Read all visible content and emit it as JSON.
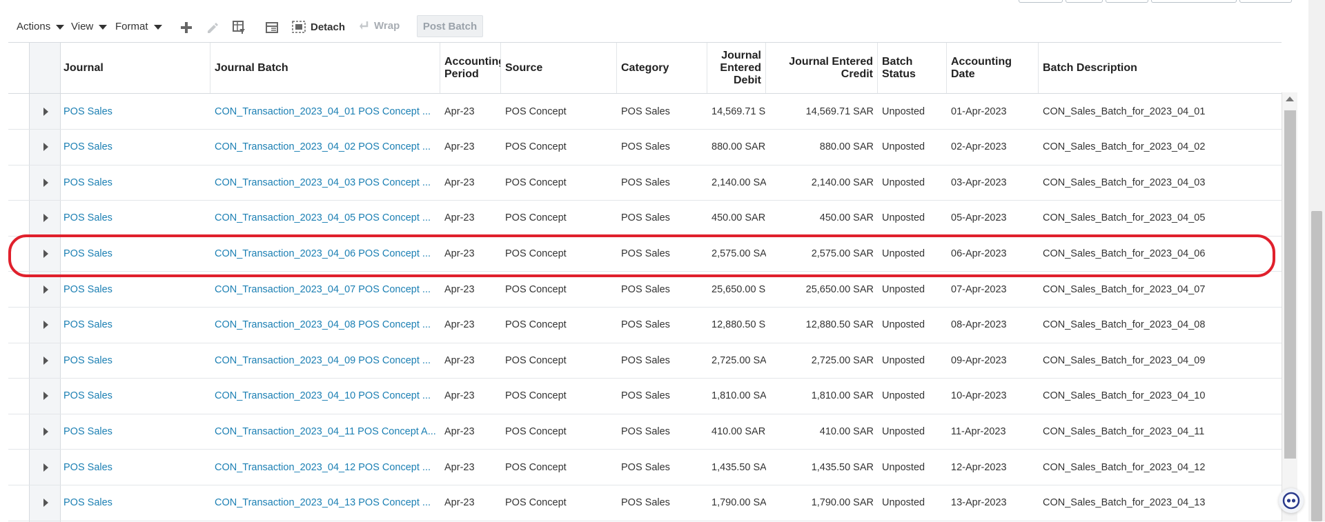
{
  "toolbar": {
    "actions_label": "Actions",
    "view_label": "View",
    "format_label": "Format",
    "detach_label": "Detach",
    "wrap_label": "Wrap",
    "post_batch_label": "Post Batch"
  },
  "table": {
    "headers": {
      "journal": "Journal",
      "journal_batch": "Journal Batch",
      "accounting_period": "Accounting Period",
      "source": "Source",
      "category": "Category",
      "journal_entered_debit": "Journal Entered Debit",
      "journal_entered_credit": "Journal Entered Credit",
      "batch_status": "Batch Status",
      "accounting_date": "Accounting Date",
      "batch_description": "Batch Description"
    },
    "rows": [
      {
        "journal": "POS Sales",
        "batch": "CON_Transaction_2023_04_01 POS Concept ...",
        "period": "Apr-23",
        "source": "POS Concept",
        "category": "POS Sales",
        "debit": "14,569.71 S",
        "credit": "14,569.71 SAR",
        "status": "Unposted",
        "date": "01-Apr-2023",
        "description": "CON_Sales_Batch_for_2023_04_01"
      },
      {
        "journal": "POS Sales",
        "batch": "CON_Transaction_2023_04_02 POS Concept ...",
        "period": "Apr-23",
        "source": "POS Concept",
        "category": "POS Sales",
        "debit": "880.00 SAR",
        "credit": "880.00 SAR",
        "status": "Unposted",
        "date": "02-Apr-2023",
        "description": "CON_Sales_Batch_for_2023_04_02"
      },
      {
        "journal": "POS Sales",
        "batch": "CON_Transaction_2023_04_03 POS Concept ...",
        "period": "Apr-23",
        "source": "POS Concept",
        "category": "POS Sales",
        "debit": "2,140.00 SA",
        "credit": "2,140.00 SAR",
        "status": "Unposted",
        "date": "03-Apr-2023",
        "description": "CON_Sales_Batch_for_2023_04_03"
      },
      {
        "journal": "POS Sales",
        "batch": "CON_Transaction_2023_04_05 POS Concept ...",
        "period": "Apr-23",
        "source": "POS Concept",
        "category": "POS Sales",
        "debit": "450.00 SAR",
        "credit": "450.00 SAR",
        "status": "Unposted",
        "date": "05-Apr-2023",
        "description": "CON_Sales_Batch_for_2023_04_05"
      },
      {
        "journal": "POS Sales",
        "batch": "CON_Transaction_2023_04_06 POS Concept ...",
        "period": "Apr-23",
        "source": "POS Concept",
        "category": "POS Sales",
        "debit": "2,575.00 SA",
        "credit": "2,575.00 SAR",
        "status": "Unposted",
        "date": "06-Apr-2023",
        "description": "CON_Sales_Batch_for_2023_04_06"
      },
      {
        "journal": "POS Sales",
        "batch": "CON_Transaction_2023_04_07 POS Concept ...",
        "period": "Apr-23",
        "source": "POS Concept",
        "category": "POS Sales",
        "debit": "25,650.00 S",
        "credit": "25,650.00 SAR",
        "status": "Unposted",
        "date": "07-Apr-2023",
        "description": "CON_Sales_Batch_for_2023_04_07"
      },
      {
        "journal": "POS Sales",
        "batch": "CON_Transaction_2023_04_08 POS Concept ...",
        "period": "Apr-23",
        "source": "POS Concept",
        "category": "POS Sales",
        "debit": "12,880.50 S",
        "credit": "12,880.50 SAR",
        "status": "Unposted",
        "date": "08-Apr-2023",
        "description": "CON_Sales_Batch_for_2023_04_08"
      },
      {
        "journal": "POS Sales",
        "batch": "CON_Transaction_2023_04_09 POS Concept ...",
        "period": "Apr-23",
        "source": "POS Concept",
        "category": "POS Sales",
        "debit": "2,725.00 SA",
        "credit": "2,725.00 SAR",
        "status": "Unposted",
        "date": "09-Apr-2023",
        "description": "CON_Sales_Batch_for_2023_04_09"
      },
      {
        "journal": "POS Sales",
        "batch": "CON_Transaction_2023_04_10 POS Concept ...",
        "period": "Apr-23",
        "source": "POS Concept",
        "category": "POS Sales",
        "debit": "1,810.00 SA",
        "credit": "1,810.00 SAR",
        "status": "Unposted",
        "date": "10-Apr-2023",
        "description": "CON_Sales_Batch_for_2023_04_10"
      },
      {
        "journal": "POS Sales",
        "batch": "CON_Transaction_2023_04_11 POS Concept A...",
        "period": "Apr-23",
        "source": "POS Concept",
        "category": "POS Sales",
        "debit": "410.00 SAR",
        "credit": "410.00 SAR",
        "status": "Unposted",
        "date": "11-Apr-2023",
        "description": "CON_Sales_Batch_for_2023_04_11"
      },
      {
        "journal": "POS Sales",
        "batch": "CON_Transaction_2023_04_12 POS Concept ...",
        "period": "Apr-23",
        "source": "POS Concept",
        "category": "POS Sales",
        "debit": "1,435.50 SA",
        "credit": "1,435.50 SAR",
        "status": "Unposted",
        "date": "12-Apr-2023",
        "description": "CON_Sales_Batch_for_2023_04_12"
      },
      {
        "journal": "POS Sales",
        "batch": "CON_Transaction_2023_04_13 POS Concept ...",
        "period": "Apr-23",
        "source": "POS Concept",
        "category": "POS Sales",
        "debit": "1,790.00 SA",
        "credit": "1,790.00 SAR",
        "status": "Unposted",
        "date": "13-Apr-2023",
        "description": "CON_Sales_Batch_for_2023_04_13"
      }
    ]
  },
  "highlighted_row_index": 4,
  "colors": {
    "link": "#1b7fb3",
    "highlight": "#e0202c"
  }
}
